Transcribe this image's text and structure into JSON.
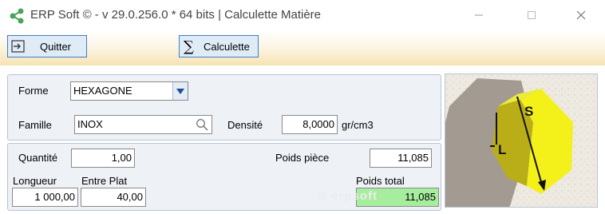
{
  "window": {
    "title": "ERP Soft © - v 29.0.256.0 * 64 bits | Calculette Matière"
  },
  "toolbar": {
    "quit_label": "Quitter",
    "calc_label": "Calculette"
  },
  "form": {
    "forme_label": "Forme",
    "forme_value": "HEXAGONE",
    "famille_label": "Famille",
    "famille_value": "INOX",
    "densite_label": "Densité",
    "densite_value": "8,0000",
    "densite_unit": "gr/cm3",
    "quantite_label": "Quantité",
    "quantite_value": "1,00",
    "poids_piece_label": "Poids pièce",
    "poids_piece_value": "11,085",
    "longueur_label": "Longueur",
    "longueur_value": "1 000,00",
    "entre_plat_label": "Entre Plat",
    "entre_plat_value": "40,00",
    "poids_total_label": "Poids total",
    "poids_total_value": "11,085"
  },
  "diagram": {
    "label_s": "S",
    "label_l": "L"
  },
  "watermark": "© erpsoft"
}
